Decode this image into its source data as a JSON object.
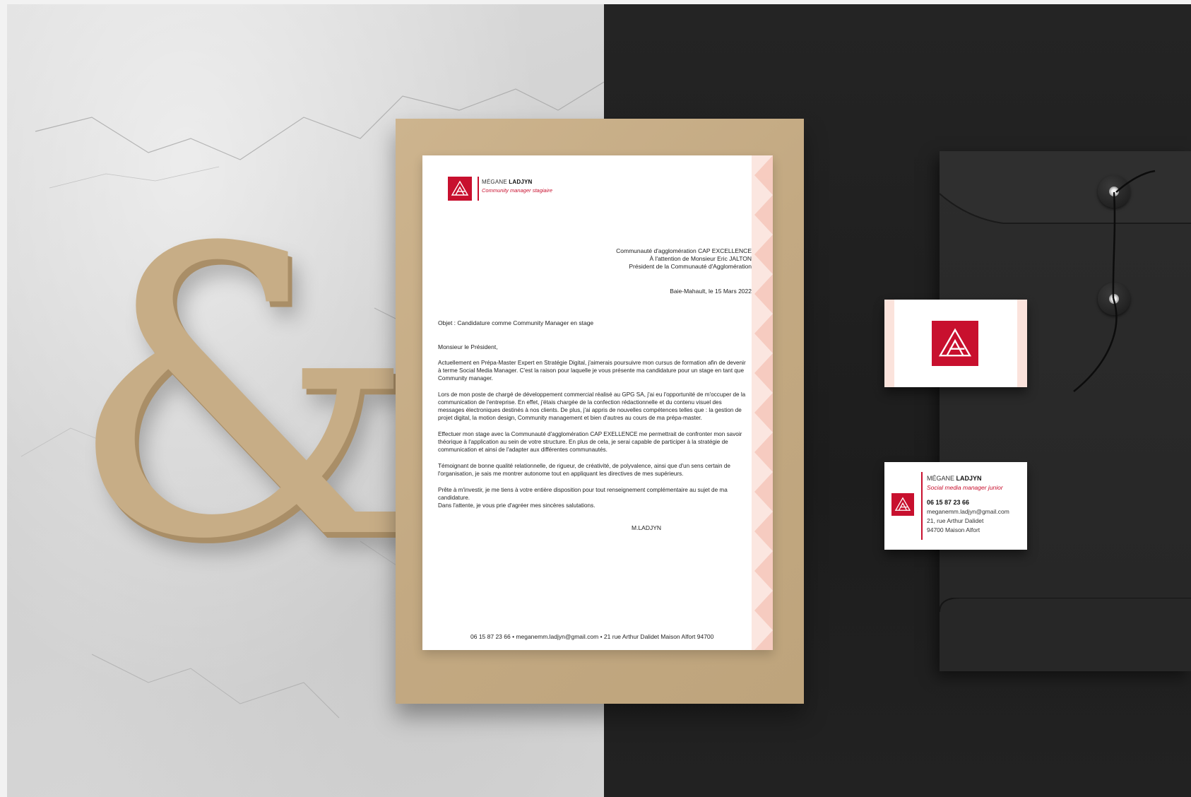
{
  "letter": {
    "brand_first": "MÉGANE ",
    "brand_last": "LADJYN",
    "role": "Community manager stagiaire",
    "address": [
      "Communauté d'agglomération CAP EXCELLENCE",
      "À l'attention de Monsieur Eric JALTON",
      "Président de la Communauté d'Agglomération"
    ],
    "date": "Baie-Mahault, le 15 Mars 2022",
    "object": "Objet : Candidature comme Community Manager en stage",
    "salutation": "Monsieur le Président,",
    "paragraphs": [
      "Actuellement en Prépa-Master Expert en Stratégie Digital, j'aimerais poursuivre mon cursus de formation afin de devenir à terme Social Media Manager. C'est la raison pour laquelle je vous présente ma candidature pour un stage en tant que Community manager.",
      "Lors de mon poste de chargé de développement commercial réalisé au GPG SA, j'ai eu l'opportunité de m'occuper de la communication de l'entreprise. En effet, j'étais chargée de la confection rédactionnelle et du contenu visuel des messages électroniques destinés à nos clients. De plus, j'ai appris de nouvelles compétences telles que : la gestion de projet digital, la motion design, Community management et bien d'autres au cours de ma prépa-master.",
      "Effectuer mon stage avec la Communauté d'agglomération CAP EXELLENCE me permettrait de confronter mon savoir théorique à l'application au sein de votre structure. En plus de cela, je serai capable de participer à la stratégie de communication et ainsi de l'adapter aux différentes communautés.",
      "Témoignant de bonne qualité relationnelle, de rigueur, de créativité, de polyvalence, ainsi que d'un sens certain de l'organisation, je sais me montrer autonome tout en appliquant les directives de mes supérieurs.",
      "Prête à m'investir, je me tiens à votre entière disposition pour tout renseignement complémentaire au sujet de ma candidature.",
      "Dans l'attente, je vous prie d'agréer mes sincères salutations."
    ],
    "signature": "M.LADJYN",
    "footer": "06 15 87 23 66 • meganemm.ladjyn@gmail.com • 21 rue Arthur Dalidet Maison Alfort 94700"
  },
  "card": {
    "name_first": "MÉGANE ",
    "name_last": "LADJYN",
    "role": "Social media manager junior",
    "phone": "06 15 87 23 66",
    "email": "meganemm.ladjyn@gmail.com",
    "street": "21, rue Arthur Dalidet",
    "city": "94700 Maison Alfort"
  },
  "colors": {
    "brand_red": "#c8102e",
    "pattern_pink": "#fbe6e0",
    "kraft": "#c3a982",
    "envelope": "#2a2a2a"
  },
  "icons": {
    "logo": "triangle-monogram-logo",
    "decor": "ampersand-decor"
  }
}
